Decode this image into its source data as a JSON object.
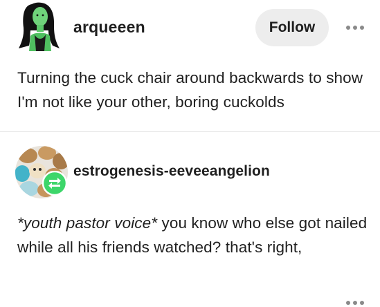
{
  "posts": [
    {
      "author": "arqueeen",
      "follow_label": "Follow",
      "body": "Turning the cuck chair around backwards to show I'm not like your other, boring cuckolds"
    },
    {
      "author": "estrogenesis-eeveeangelion",
      "body_italic": "*youth pastor voice*",
      "body_rest": " you know who else got nailed while all his friends watched? that's right,"
    }
  ],
  "icons": {
    "avatar_1": "green-skinned-woman-avatar",
    "avatar_2": "eevee-plush-avatar",
    "reblog": "reblog-icon",
    "more": "more-options-icon"
  },
  "colors": {
    "follow_bg": "#ededed",
    "reblog_badge": "#3dd66a",
    "divider": "#e6e6e6"
  }
}
